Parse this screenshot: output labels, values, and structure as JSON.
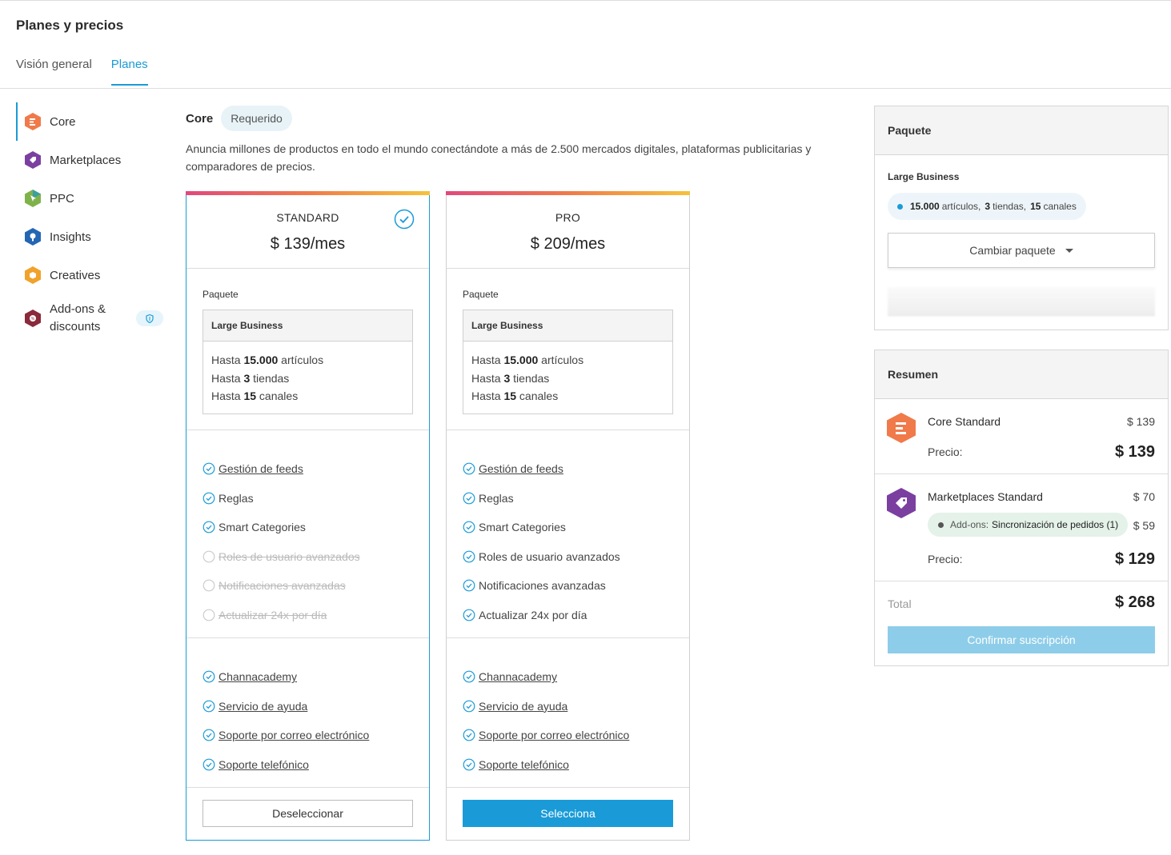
{
  "page": {
    "title": "Planes y precios"
  },
  "tabs": [
    {
      "label": "Visión general",
      "active": false
    },
    {
      "label": "Planes",
      "active": true
    }
  ],
  "sidebar": {
    "items": [
      {
        "label": "Core",
        "icon": "core-icon",
        "color": "#f07a4a",
        "active": true
      },
      {
        "label": "Marketplaces",
        "icon": "marketplaces-icon",
        "color": "#7b3fa0",
        "active": false
      },
      {
        "label": "PPC",
        "icon": "ppc-icon",
        "color": "#3aa0a0",
        "active": false
      },
      {
        "label": "Insights",
        "icon": "insights-icon",
        "color": "#2466b3",
        "active": false
      },
      {
        "label": "Creatives",
        "icon": "creatives-icon",
        "color": "#f0a22a",
        "active": false
      },
      {
        "label": "Add-ons & discounts",
        "icon": "addons-icon",
        "color": "#8a2a3a",
        "active": false
      }
    ]
  },
  "main": {
    "section_label": "Core",
    "required_pill": "Requerido",
    "description": "Anuncia millones de productos en todo el mundo conectándote a más de 2.500 mercados digitales, plataformas publicitarias y comparadores de precios."
  },
  "plans": [
    {
      "name": "STANDARD",
      "price": "$ 139/mes",
      "selected": true,
      "package_label": "Paquete",
      "package_name": "Large Business",
      "limits": [
        {
          "pre": "Hasta ",
          "num": "15.000",
          "post": " artículos"
        },
        {
          "pre": "Hasta ",
          "num": "3",
          "post": " tiendas"
        },
        {
          "pre": "Hasta ",
          "num": "15",
          "post": " canales"
        }
      ],
      "features": [
        {
          "label": "Gestión de feeds",
          "enabled": true,
          "link": true
        },
        {
          "label": "Reglas",
          "enabled": true,
          "link": false
        },
        {
          "label": "Smart Categories",
          "enabled": true,
          "link": false
        },
        {
          "label": "Roles de usuario avanzados",
          "enabled": false,
          "link": false
        },
        {
          "label": "Notificaciones avanzadas",
          "enabled": false,
          "link": false
        },
        {
          "label": "Actualizar 24x por día",
          "enabled": false,
          "link": false
        }
      ],
      "support": [
        "Channacademy",
        "Servicio de ayuda",
        "Soporte por correo electrónico",
        "Soporte telefónico"
      ],
      "button": "Deseleccionar"
    },
    {
      "name": "PRO",
      "price": "$ 209/mes",
      "selected": false,
      "package_label": "Paquete",
      "package_name": "Large Business",
      "limits": [
        {
          "pre": "Hasta ",
          "num": "15.000",
          "post": " artículos"
        },
        {
          "pre": "Hasta ",
          "num": "3",
          "post": " tiendas"
        },
        {
          "pre": "Hasta ",
          "num": "15",
          "post": " canales"
        }
      ],
      "features": [
        {
          "label": "Gestión de feeds",
          "enabled": true,
          "link": true
        },
        {
          "label": "Reglas",
          "enabled": true,
          "link": false
        },
        {
          "label": "Smart Categories",
          "enabled": true,
          "link": false
        },
        {
          "label": "Roles de usuario avanzados",
          "enabled": true,
          "link": false
        },
        {
          "label": "Notificaciones avanzadas",
          "enabled": true,
          "link": false
        },
        {
          "label": "Actualizar 24x por día",
          "enabled": true,
          "link": false
        }
      ],
      "support": [
        "Channacademy",
        "Servicio de ayuda",
        "Soporte por correo electrónico",
        "Soporte telefónico"
      ],
      "button": "Selecciona"
    }
  ],
  "package_panel": {
    "title": "Paquete",
    "name": "Large Business",
    "chip": {
      "n1": "15.000",
      "w1": "artículos,",
      "n2": "3",
      "w2": "tiendas,",
      "n3": "15",
      "w3": "canales"
    },
    "change_button": "Cambiar paquete"
  },
  "summary": {
    "title": "Resumen",
    "rows": [
      {
        "name": "Core Standard",
        "amount": "$ 139",
        "price_label": "Precio:",
        "price": "$ 139",
        "icon": "core-icon"
      },
      {
        "name": "Marketplaces Standard",
        "amount": "$ 70",
        "addon_label": "Add-ons:",
        "addon_value": "Sincronización de pedidos (1)",
        "addon_amount": "$ 59",
        "price_label": "Precio:",
        "price": "$ 129",
        "icon": "marketplaces-icon"
      }
    ],
    "total_label": "Total",
    "total": "$ 268",
    "confirm_button": "Confirmar suscripción"
  },
  "colors": {
    "accent": "#1a9bd7",
    "confirm_disabled": "#8ecde9"
  }
}
